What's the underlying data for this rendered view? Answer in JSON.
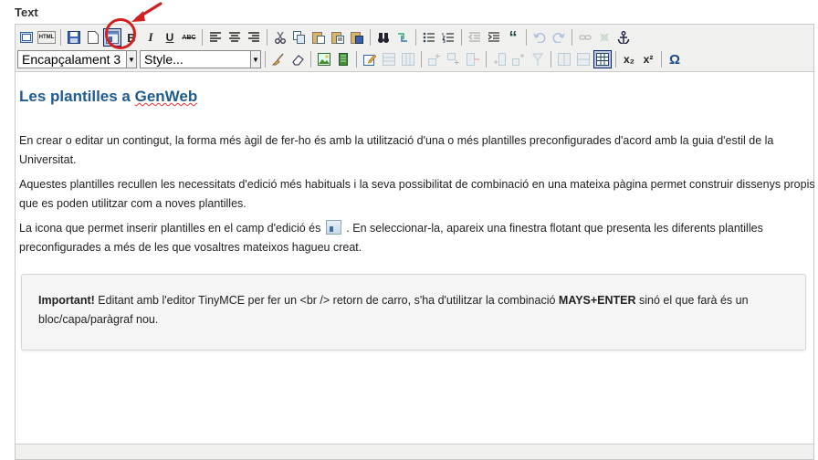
{
  "field_label": "Text",
  "toolbar": {
    "heading_select": "Encapçalament 3",
    "style_select": "Style...",
    "html_btn": "HTML",
    "bold": "B",
    "italic": "I",
    "underline": "U",
    "strike": "ABC",
    "quote": "“",
    "sub": "x₂",
    "sup": "x²",
    "omega": "Ω"
  },
  "content": {
    "heading_prefix": "Les plantilles a ",
    "heading_spell": "GenWeb",
    "p1": "En crear o editar un contingut, la forma més àgil de fer-ho és amb la utilització d'una o més plantilles preconfigurades d'acord amb la guia d'estil de la Universitat.",
    "p2": "Aquestes plantilles recullen les necessitats d'edició més habituals i la seva possibilitat de combinació en una mateixa pàgina permet  construir dissenys propis que es poden utilitzar  com a noves plantilles.",
    "p3_before": "La icona que permet inserir plantilles en el camp d'edició és ",
    "p3_after": " . En seleccionar-la, apareix una finestra flotant que presenta les diferents plantilles preconfigurades a més de les que vosaltres mateixos hagueu creat.",
    "notice_strong1": "Important!",
    "notice_text1": " Editant amb l'editor TinyMCE per fer un <br /> retorn de carro, s'ha d'utilitzar la combinació ",
    "notice_strong2": "MAYS+ENTER",
    "notice_text2": " sinó el que farà és un bloc/capa/paràgraf nou."
  },
  "colors": {
    "heading": "#205c90",
    "annotation": "#d21f1f"
  }
}
